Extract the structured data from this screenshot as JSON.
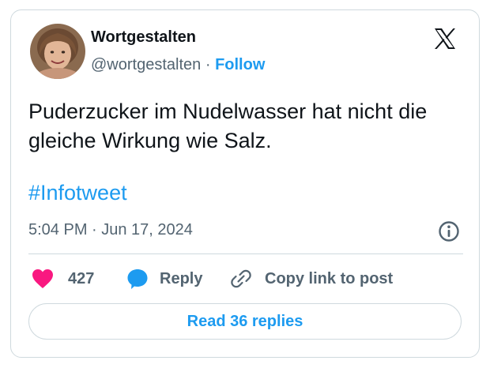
{
  "author": {
    "display_name": "Wortgestalten",
    "handle": "@wortgestalten",
    "separator": "·",
    "follow_label": "Follow",
    "avatar_icon": "user-photo"
  },
  "platform_icon": "x-logo-icon",
  "tweet": {
    "text": "Puderzucker im Nudelwasser hat nicht die gleiche Wirkung wie Salz.",
    "hashtag": "#Infotweet",
    "timestamp": "5:04 PM · Jun 17, 2024"
  },
  "actions": {
    "like_count": "427",
    "reply_label": "Reply",
    "copy_link_label": "Copy link to post"
  },
  "read_replies_label": "Read 36 replies",
  "colors": {
    "accent": "#1d9bf0",
    "like": "#f91880",
    "text": "#0f1419",
    "muted": "#536471",
    "border": "#cfd9de"
  }
}
